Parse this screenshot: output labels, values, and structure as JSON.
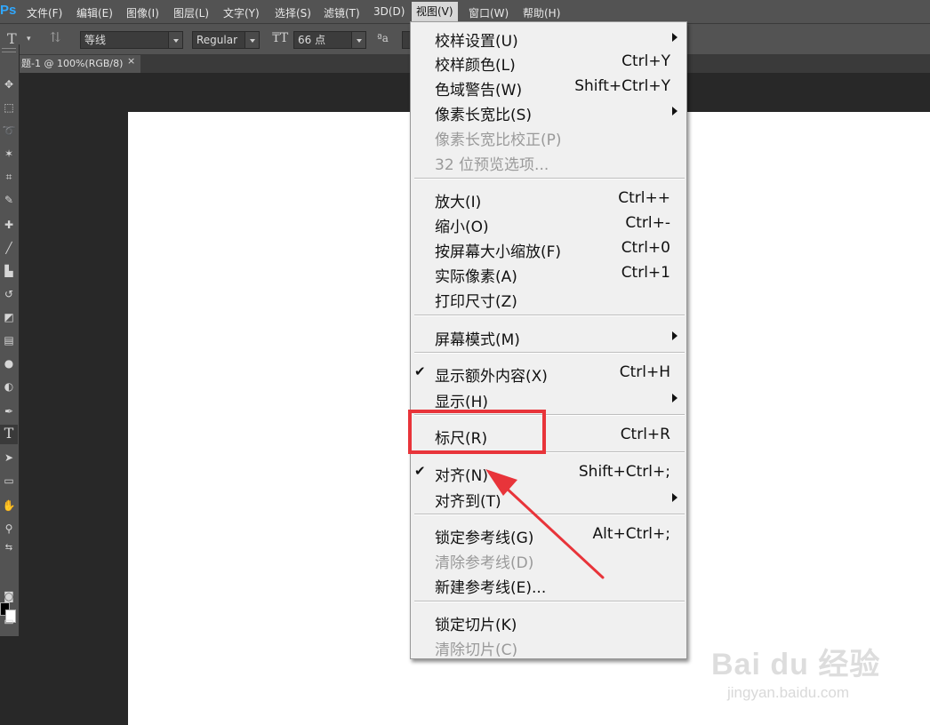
{
  "app": {
    "logo": "Ps"
  },
  "menubar": {
    "items": [
      "文件(F)",
      "编辑(E)",
      "图像(I)",
      "图层(L)",
      "文字(Y)",
      "选择(S)",
      "滤镜(T)",
      "3D(D)",
      "视图(V)",
      "窗口(W)",
      "帮助(H)"
    ],
    "active": "视图(V)"
  },
  "options": {
    "font_family": "等线",
    "font_style": "Regular",
    "font_size": "66 点",
    "antialias_icon_label": "ªa"
  },
  "document_tab": {
    "title": "题-1 @ 100%(RGB/8)",
    "close": "×"
  },
  "view_menu": {
    "items": [
      {
        "label": "校样设置(U)",
        "shortcut": "",
        "submenu": true,
        "disabled": false,
        "checked": false
      },
      {
        "label": "校样颜色(L)",
        "shortcut": "Ctrl+Y",
        "submenu": false,
        "disabled": false,
        "checked": false
      },
      {
        "label": "色域警告(W)",
        "shortcut": "Shift+Ctrl+Y",
        "submenu": false,
        "disabled": false,
        "checked": false
      },
      {
        "label": "像素长宽比(S)",
        "shortcut": "",
        "submenu": true,
        "disabled": false,
        "checked": false
      },
      {
        "label": "像素长宽比校正(P)",
        "shortcut": "",
        "submenu": false,
        "disabled": true,
        "checked": false
      },
      {
        "label": "32 位预览选项...",
        "shortcut": "",
        "submenu": false,
        "disabled": true,
        "checked": false
      },
      {
        "label": "放大(I)",
        "shortcut": "Ctrl++",
        "submenu": false,
        "disabled": false,
        "checked": false
      },
      {
        "label": "缩小(O)",
        "shortcut": "Ctrl+-",
        "submenu": false,
        "disabled": false,
        "checked": false
      },
      {
        "label": "按屏幕大小缩放(F)",
        "shortcut": "Ctrl+0",
        "submenu": false,
        "disabled": false,
        "checked": false
      },
      {
        "label": "实际像素(A)",
        "shortcut": "Ctrl+1",
        "submenu": false,
        "disabled": false,
        "checked": false
      },
      {
        "label": "打印尺寸(Z)",
        "shortcut": "",
        "submenu": false,
        "disabled": false,
        "checked": false
      },
      {
        "label": "屏幕模式(M)",
        "shortcut": "",
        "submenu": true,
        "disabled": false,
        "checked": false
      },
      {
        "label": "显示额外内容(X)",
        "shortcut": "Ctrl+H",
        "submenu": false,
        "disabled": false,
        "checked": true
      },
      {
        "label": "显示(H)",
        "shortcut": "",
        "submenu": true,
        "disabled": false,
        "checked": false
      },
      {
        "label": "标尺(R)",
        "shortcut": "Ctrl+R",
        "submenu": false,
        "disabled": false,
        "checked": false
      },
      {
        "label": "对齐(N)",
        "shortcut": "Shift+Ctrl+;",
        "submenu": false,
        "disabled": false,
        "checked": true
      },
      {
        "label": "对齐到(T)",
        "shortcut": "",
        "submenu": true,
        "disabled": false,
        "checked": false
      },
      {
        "label": "锁定参考线(G)",
        "shortcut": "Alt+Ctrl+;",
        "submenu": false,
        "disabled": false,
        "checked": false
      },
      {
        "label": "清除参考线(D)",
        "shortcut": "",
        "submenu": false,
        "disabled": true,
        "checked": false
      },
      {
        "label": "新建参考线(E)...",
        "shortcut": "",
        "submenu": false,
        "disabled": false,
        "checked": false
      },
      {
        "label": "锁定切片(K)",
        "shortcut": "",
        "submenu": false,
        "disabled": false,
        "checked": false
      },
      {
        "label": "清除切片(C)",
        "shortcut": "",
        "submenu": false,
        "disabled": true,
        "checked": false
      }
    ],
    "check_glyph": "✔"
  },
  "watermark": {
    "logo_text": "Bai du 经验",
    "url": "jingyan.baidu.com"
  },
  "colors": {
    "highlight": "#e8343a",
    "foreground": "#000000",
    "background": "#ffffff"
  }
}
